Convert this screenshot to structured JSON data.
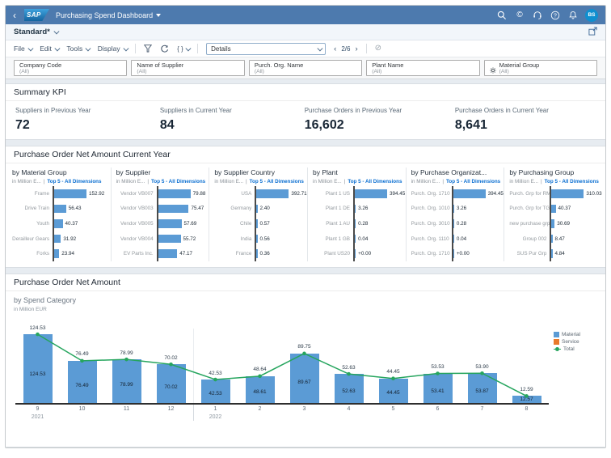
{
  "shell": {
    "product": "SAP",
    "title": "Purchasing Spend Dashboard",
    "avatar": "BS",
    "icons": [
      "search",
      "copilot",
      "headset",
      "help",
      "notifications"
    ]
  },
  "variant_bar": {
    "variant": "Standard*"
  },
  "toolbar": {
    "menus": [
      "File",
      "Edit",
      "Tools",
      "Display"
    ],
    "details_value": "Details",
    "pagination": "2/6",
    "code_label": "{ }"
  },
  "filters": [
    {
      "label": "Company Code",
      "value": "(All)"
    },
    {
      "label": "Name of Supplier",
      "value": "(All)"
    },
    {
      "label": "Purch. Org. Name",
      "value": "(All)"
    },
    {
      "label": "Plant Name",
      "value": "(All)"
    },
    {
      "label": "Material Group",
      "value": "(All)",
      "icon": "gear"
    }
  ],
  "summary_kpi": {
    "title": "Summary KPI",
    "items": [
      {
        "label": "Suppliers in Previous Year",
        "value": "72"
      },
      {
        "label": "Suppliers in Current Year",
        "value": "84"
      },
      {
        "label": "Purchase Orders in Previous Year",
        "value": "16,602"
      },
      {
        "label": "Purchase Orders in Current Year",
        "value": "8,641"
      }
    ]
  },
  "sections": {
    "current_year_title": "Purchase Order Net Amount Current Year"
  },
  "colors": {
    "shell_blue": "#4d7aae",
    "bar_blue": "#5b9bd5",
    "service_orange": "#e97a2b",
    "total_green": "#26a55e",
    "link_blue": "#0a6ed1"
  },
  "chart_data": [
    {
      "type": "bar",
      "orientation": "horizontal",
      "title": "by Material Group",
      "unit": "in Million E...",
      "link": "Top 5 - All Dimensions",
      "categories": [
        "Frame",
        "Drive Train",
        "Youth",
        "Derailleur Gears",
        "Forks"
      ],
      "values": [
        152.92,
        56.43,
        40.37,
        31.92,
        23.94
      ],
      "value_labels": [
        "152.92",
        "56.43",
        "40.37",
        "31.92",
        "23.94"
      ]
    },
    {
      "type": "bar",
      "orientation": "horizontal",
      "title": "by Supplier",
      "unit": "in Million E...",
      "link": "Top 5 - All Dimensions",
      "categories": [
        "Vendor VB007",
        "Vendor VB003",
        "Vendor VB005",
        "Vendor VB004",
        "EV Parts Inc."
      ],
      "values": [
        79.88,
        75.47,
        57.69,
        55.72,
        47.17
      ],
      "value_labels": [
        "79.88",
        "75.47",
        "57.69",
        "55.72",
        "47.17"
      ]
    },
    {
      "type": "bar",
      "orientation": "horizontal",
      "title": "by Supplier Country",
      "unit": "in Million E...",
      "link": "Top 5 - All Dimensions",
      "categories": [
        "USA",
        "Germany",
        "Chile",
        "India",
        "France"
      ],
      "values": [
        392.71,
        2.4,
        0.57,
        0.56,
        0.36
      ],
      "value_labels": [
        "392.71",
        "2.40",
        "0.57",
        "0.56",
        "0.36"
      ]
    },
    {
      "type": "bar",
      "orientation": "horizontal",
      "title": "by Plant",
      "unit": "in Million E...",
      "link": "Top 5 - All Dimensions",
      "categories": [
        "Plant 1 US",
        "Plant 1 DE",
        "Plant 1 AU",
        "Plant 1 GB",
        "Plant US20"
      ],
      "values": [
        394.45,
        3.26,
        0.28,
        0.04,
        0
      ],
      "value_labels": [
        "394.45",
        "3.26",
        "0.28",
        "0.04",
        "+0.00"
      ]
    },
    {
      "type": "bar",
      "orientation": "horizontal",
      "title": "by Purchase Organizat...",
      "unit": "in Million E...",
      "link": "Top 5 - All Dimensions",
      "categories": [
        "Purch. Org. 1710",
        "Purch. Org. 1010",
        "Purch. Org. 3010",
        "Purch. Org. 1110",
        "Purch. Org. 1710"
      ],
      "values": [
        394.45,
        3.26,
        0.28,
        0.04,
        0
      ],
      "value_labels": [
        "394.45",
        "3.26",
        "0.28",
        "0.04",
        "+0.00"
      ]
    },
    {
      "type": "bar",
      "orientation": "horizontal",
      "title": "by Purchasing Group",
      "unit": "in Million E...",
      "link": "Top 5 - All Dimensions",
      "categories": [
        "Purch. Grp for RM",
        "Purch. Grp for TG",
        "new purchase grp",
        "Group 002",
        "SUS Pur Grp"
      ],
      "values": [
        310.03,
        40.37,
        30.69,
        8.47,
        4.84
      ],
      "value_labels": [
        "310.03",
        "40.37",
        "30.69",
        "8.47",
        "4.84"
      ]
    },
    {
      "type": "bar+line",
      "orientation": "vertical",
      "title": "Purchase Order Net Amount",
      "subtitle": "by Spend Category",
      "unit": "in Million EUR",
      "categories": [
        "9",
        "10",
        "11",
        "12",
        "1",
        "2",
        "3",
        "4",
        "5",
        "6",
        "7",
        "8"
      ],
      "year_groups": [
        {
          "label": "2021",
          "start_index": 0
        },
        {
          "label": "2022",
          "start_index": 4
        }
      ],
      "series": [
        {
          "name": "Material",
          "values": [
            124.53,
            76.49,
            78.99,
            70.02,
            42.53,
            48.61,
            89.67,
            52.63,
            44.45,
            53.41,
            53.87,
            12.57
          ],
          "labels": [
            "124.53",
            "76.49",
            "78.99",
            "70.02",
            "42.53",
            "48.61",
            "89.67",
            "52.63",
            "44.45",
            "53.41",
            "53.87",
            "12.57"
          ]
        },
        {
          "name": "Service",
          "values": [
            0,
            0,
            0,
            0,
            0,
            0.03,
            0.08,
            0,
            0,
            0.12,
            0.03,
            0.02
          ]
        },
        {
          "name": "Total",
          "values": [
            124.53,
            76.49,
            78.99,
            70.02,
            42.53,
            48.64,
            89.75,
            52.63,
            44.45,
            53.53,
            53.9,
            12.59
          ],
          "labels": [
            "124.53",
            "76.49",
            "78.99",
            "70.02",
            "42.53",
            "48.64",
            "89.75",
            "52.63",
            "44.45",
            "53.53",
            "53.90",
            "12.59"
          ]
        }
      ],
      "legend": [
        "Material",
        "Service",
        "Total"
      ],
      "legend_position": "right",
      "ylim": [
        0,
        135
      ],
      "grid": false
    }
  ]
}
